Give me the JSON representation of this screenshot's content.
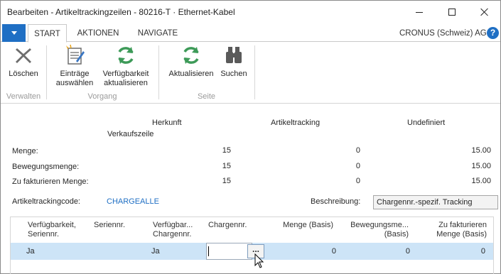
{
  "window": {
    "title": "Bearbeiten - Artikeltrackingzeilen - 80216-T · Ethernet-Kabel"
  },
  "tabs": {
    "start": "START",
    "aktionen": "AKTIONEN",
    "navigate": "NAVIGATE"
  },
  "company": "CRONUS (Schweiz) AG",
  "help_label": "?",
  "ribbon": {
    "loeschen": "Löschen",
    "eintraege_l1": "Einträge",
    "eintraege_l2": "auswählen",
    "verfueg_l1": "Verfügbarkeit",
    "verfueg_l2": "aktualisieren",
    "aktualisieren": "Aktualisieren",
    "suchen": "Suchen",
    "groups": {
      "verwalten": "Verwalten",
      "vorgang": "Vorgang",
      "seite": "Seite"
    },
    "icons": [
      "delete-x-icon",
      "select-entries-icon",
      "refresh-icon",
      "refresh-icon",
      "binoculars-icon"
    ]
  },
  "summary": {
    "col_herkunft": "Herkunft",
    "col_herkunft_sub": "Verkaufszeile",
    "col_artikeltracking": "Artikeltracking",
    "col_undefiniert": "Undefiniert",
    "rows": [
      {
        "label": "Menge:",
        "herkunft": "15",
        "tracking": "0",
        "undefiniert": "15.00"
      },
      {
        "label": "Bewegungsmenge:",
        "herkunft": "15",
        "tracking": "0",
        "undefiniert": "15.00"
      },
      {
        "label": "Zu fakturieren Menge:",
        "herkunft": "15",
        "tracking": "0",
        "undefiniert": "15.00"
      }
    ]
  },
  "tracking": {
    "code_label": "Artikeltrackingcode:",
    "code_value": "CHARGEALLE",
    "desc_label": "Beschreibung:",
    "desc_value": "Chargennr.-spezif. Tracking"
  },
  "grid": {
    "headers": {
      "verf_serien_l1": "Verfügbarkeit,",
      "verf_serien_l2": "Seriennr.",
      "seriennr": "Seriennr.",
      "verf_charge_l1": "Verfügbar...",
      "verf_charge_l2": "Chargennr.",
      "chargennr": "Chargennr.",
      "menge": "Menge (Basis)",
      "bew_l1": "Bewegungsme...",
      "bew_l2": "(Basis)",
      "zuf_l1": "Zu fakturieren",
      "zuf_l2": "Menge (Basis)"
    },
    "row": {
      "verf_serien": "Ja",
      "seriennr": "",
      "verf_charge": "Ja",
      "chargennr": "",
      "assist_button": "...",
      "menge": "0",
      "bewegung": "0",
      "zu_fakturieren": "0"
    }
  },
  "colors": {
    "accent": "#1f6fc4",
    "selected_row": "#cde4f7",
    "group_label": "#9a9a9a"
  }
}
